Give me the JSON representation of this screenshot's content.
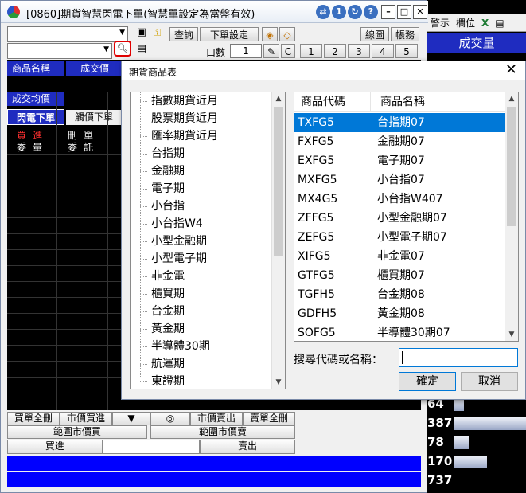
{
  "main_window": {
    "title": "[0860]期貨智慧閃電下單(智慧單設定為當盤有效)",
    "toolbar": {
      "query_label": "查詢",
      "order_settings_label": "下單設定",
      "chart_label": "線圖",
      "account_label": "帳務",
      "lots_label": "口數",
      "lots_value": "1",
      "c_label": "C",
      "qty_buttons": [
        "1",
        "2",
        "3",
        "4",
        "5"
      ]
    },
    "columns": {
      "product_name": "商品名稱",
      "volume": "成交價",
      "avg_price": "成交均價"
    },
    "tabs": {
      "flash_order": "閃電下單",
      "touch_order": "觸價下單"
    },
    "order_headers": {
      "buy": "買進",
      "buy_qty": "委量",
      "delete": "刪單",
      "entrust": "委託"
    },
    "bottom": {
      "cancel_all_buy": "買單全刪",
      "market_buy": "市價買進",
      "down_arrow": "▼",
      "circle": "◎",
      "market_sell": "市價賣出",
      "cancel_all_sell": "賣單全刪",
      "range_market_buy": "範圍市價買",
      "range_market_sell": "範圍市價賣",
      "buy": "買進",
      "sell": "賣出"
    }
  },
  "right_panel": {
    "toolbar": [
      "警示",
      "欄位"
    ],
    "header": "成交量",
    "rows": [
      {
        "num": "64",
        "bar": 0.13
      },
      {
        "num": "387",
        "bar": 1.0
      },
      {
        "num": "78",
        "bar": 0.2
      },
      {
        "num": "170",
        "bar": 0.45
      },
      {
        "num": "737",
        "bar": 0.0
      }
    ]
  },
  "dialog": {
    "title": "期貨商品表",
    "close": "✕",
    "tree_items": [
      "指數期貨近月",
      "股票期貨近月",
      "匯率期貨近月",
      "台指期",
      "金融期",
      "電子期",
      "小台指",
      "小台指W4",
      "小型金融期",
      "小型電子期",
      "非金電",
      "櫃買期",
      "台金期",
      "黃金期",
      "半導體30期",
      "航運期",
      "東證期"
    ],
    "list_headers": {
      "code": "商品代碼",
      "name": "商品名稱"
    },
    "list_rows": [
      {
        "code": "TXFG5",
        "name": "台指期07"
      },
      {
        "code": "FXFG5",
        "name": "金融期07"
      },
      {
        "code": "EXFG5",
        "name": "電子期07"
      },
      {
        "code": "MXFG5",
        "name": "小台指07"
      },
      {
        "code": "MX4G5",
        "name": "小台指W407"
      },
      {
        "code": "ZFFG5",
        "name": "小型金融期07"
      },
      {
        "code": "ZEFG5",
        "name": "小型電子期07"
      },
      {
        "code": "XIFG5",
        "name": "非金電07"
      },
      {
        "code": "GTFG5",
        "name": "櫃買期07"
      },
      {
        "code": "TGFH5",
        "name": "台金期08"
      },
      {
        "code": "GDFH5",
        "name": "黃金期08"
      },
      {
        "code": "SOFG5",
        "name": "半導體30期07"
      }
    ],
    "selected_index": 0,
    "search_label": "搜尋代碼或名稱：",
    "search_value": "",
    "confirm_label": "確定",
    "cancel_label": "取消"
  }
}
